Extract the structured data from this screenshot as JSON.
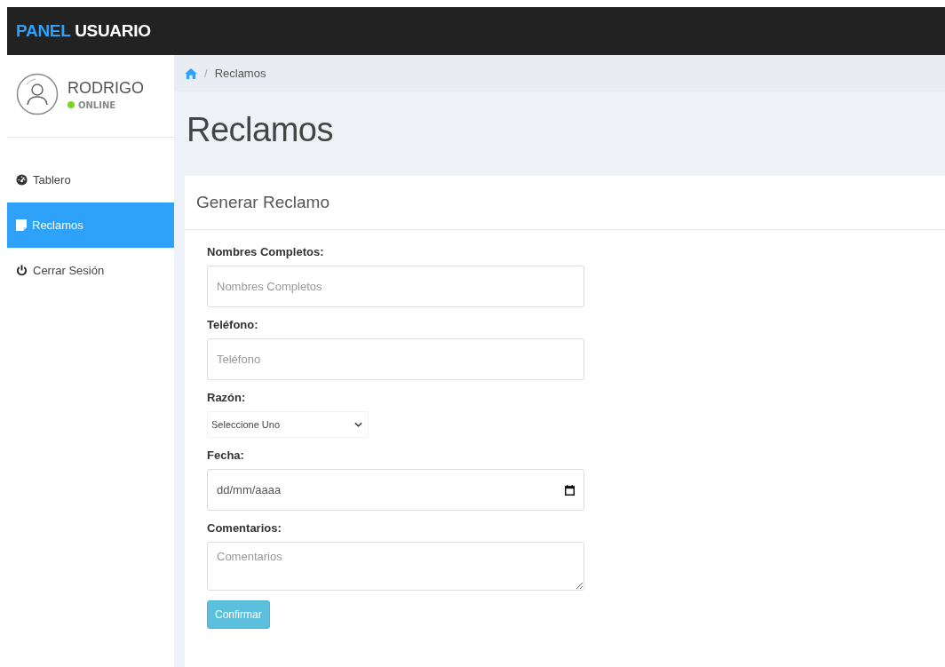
{
  "brand": {
    "part_1": "PANEL",
    "part_2": "USUARIO"
  },
  "user": {
    "name": "RODRIGO",
    "status": "ONLINE",
    "online": true
  },
  "sidebar": {
    "items": [
      {
        "label": "Tablero",
        "kind": "dashboard",
        "selected": false
      },
      {
        "label": "Reclamos",
        "kind": "note",
        "selected": true
      },
      {
        "label": "Cerrar Sesión",
        "kind": "power",
        "selected": false
      }
    ]
  },
  "breadcrumb": {
    "separator": "/",
    "current": "Reclamos"
  },
  "page_title": "Reclamos",
  "card": {
    "title": "Generar Reclamo",
    "fields": [
      {
        "kind": "text",
        "label": "Nombres Completos:",
        "placeholder": "Nombres Completos"
      },
      {
        "kind": "text",
        "label": "Teléfono:",
        "placeholder": "Teléfono"
      },
      {
        "kind": "select",
        "label": "Razón:",
        "value": "Seleccione Uno"
      },
      {
        "kind": "date",
        "label": "Fecha:",
        "placeholder": "dd/mm/aaaa"
      },
      {
        "kind": "textarea",
        "label": "Comentarios:",
        "placeholder": "Comentarios"
      }
    ],
    "submit": "Confirmar"
  }
}
